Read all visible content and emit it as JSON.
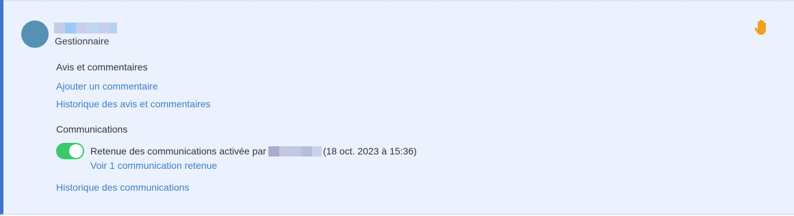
{
  "user": {
    "role": "Gestionnaire"
  },
  "reviews": {
    "title": "Avis et commentaires",
    "add_comment": "Ajouter un commentaire",
    "history": "Historique des avis et commentaires"
  },
  "communications": {
    "title": "Communications",
    "hold_enabled": true,
    "hold_prefix": "Retenue des communications activée par",
    "hold_date": "(18 oct. 2023 à 15:36)",
    "view_held": "Voir 1 communication retenue",
    "history": "Historique des communications"
  },
  "colors": {
    "accent": "#3b74d1",
    "toggle_on": "#3cc96b",
    "hand_icon": "#f0a01e",
    "avatar": "#5491b3"
  },
  "icons": {
    "status": "raised-hand-icon"
  }
}
